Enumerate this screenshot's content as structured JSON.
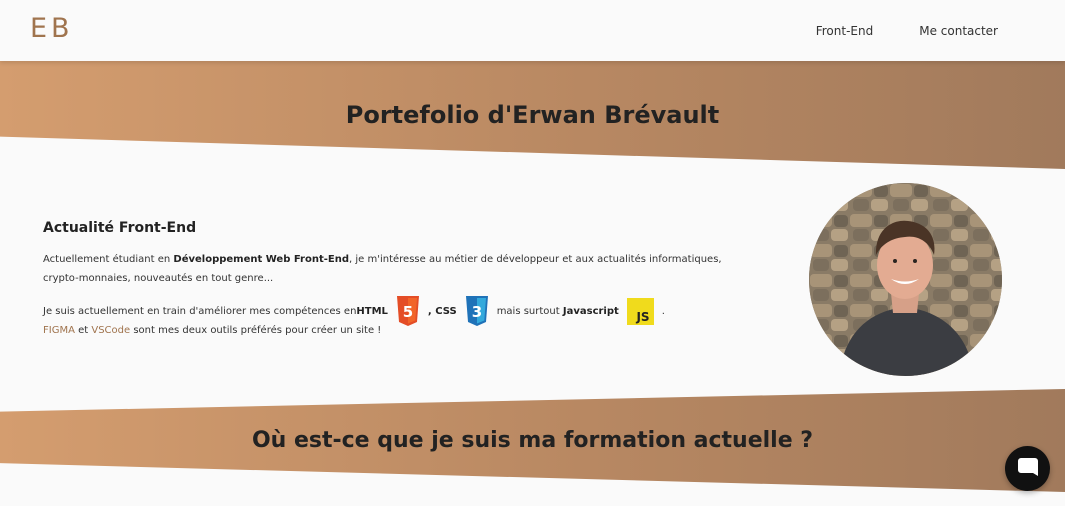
{
  "header": {
    "logo": "EB",
    "nav": [
      {
        "label": "Front-End"
      },
      {
        "label": "Me contacter"
      }
    ]
  },
  "hero": {
    "title": "Portefolio d'Erwan Brévault"
  },
  "about": {
    "heading": "Actualité Front-End",
    "intro_prefix": "Actuellement étudiant en ",
    "intro_bold": "Développement Web Front-End",
    "intro_suffix": ", je m'intéresse au métier de développeur et aux actualités informatiques, crypto-monnaies, nouveautés en tout genre...",
    "skills_prefix": "Je suis actuellement en train d'améliorer mes compétences en ",
    "skill_html": "HTML",
    "skill_css": ", CSS",
    "skills_mid": "mais surtout ",
    "skill_js": "Javascript",
    "skills_end": ".",
    "tool_figma": "FIGMA",
    "tools_and": " et ",
    "tool_vscode": "VSCode",
    "tools_suffix": " sont mes deux outils préférés pour créer un site !",
    "badges": {
      "html_label": "5",
      "css_label": "3",
      "js_label": "JS",
      "html_color": "#e44d26",
      "css_color": "#1f72b8",
      "js_color": "#f0db1c"
    }
  },
  "formation": {
    "title": "Où est-ce que je suis ma formation actuelle ?"
  },
  "colors": {
    "accent": "#a0744e",
    "banner_start": "#d49d6f",
    "banner_end": "#a17a5c"
  }
}
